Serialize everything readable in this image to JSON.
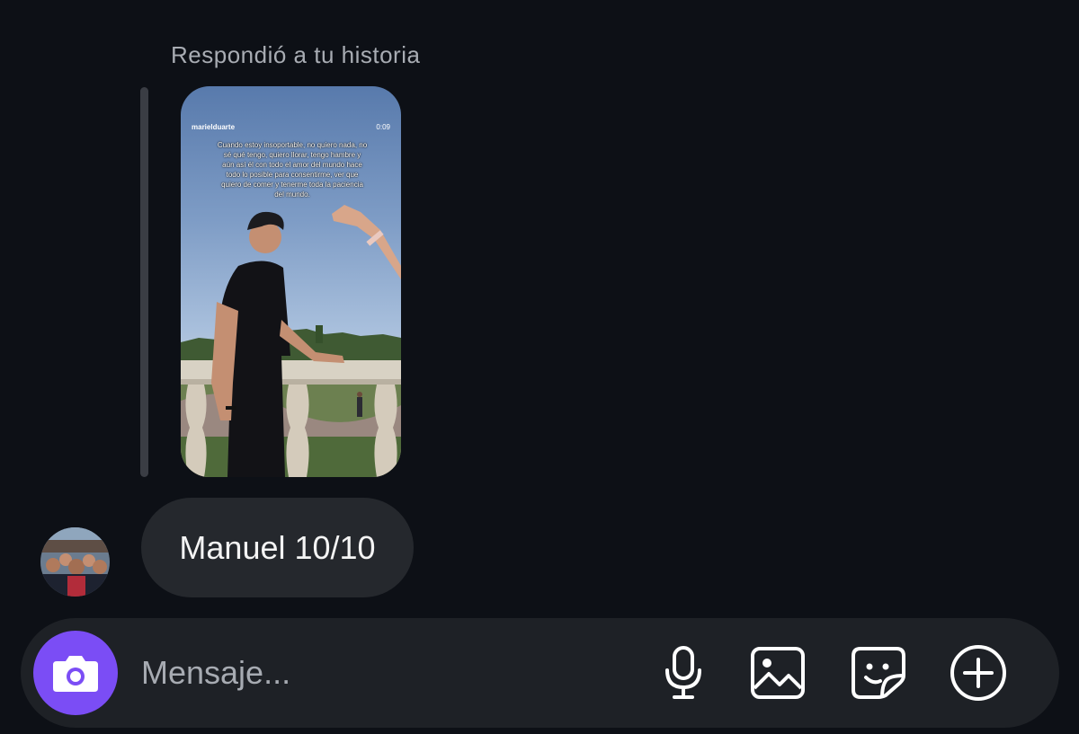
{
  "thread": {
    "reply_label": "Respondió a tu historia"
  },
  "story": {
    "username": "marielduarte",
    "time": "0:09",
    "caption": "Cuando estoy insoportable, no quiero nada, no sé qué tengo, quiero llorar, tengo hambre y aún así él con todo el amor del mundo hace todo lo posible para consentirme, ver que quiero de comer y tenerme toda la paciencia del mundo."
  },
  "message": {
    "text": "Manuel 10/10"
  },
  "composer": {
    "placeholder": "Mensaje..."
  },
  "icons": {
    "camera": "camera-icon",
    "microphone": "microphone-icon",
    "gallery": "gallery-icon",
    "sticker": "sticker-icon",
    "add": "plus-circle-icon"
  },
  "colors": {
    "background": "#0d1016",
    "bubble": "#25282d",
    "composer": "#1e2126",
    "camera_accent": "#7b4df5",
    "muted_text": "#a8acb3"
  }
}
